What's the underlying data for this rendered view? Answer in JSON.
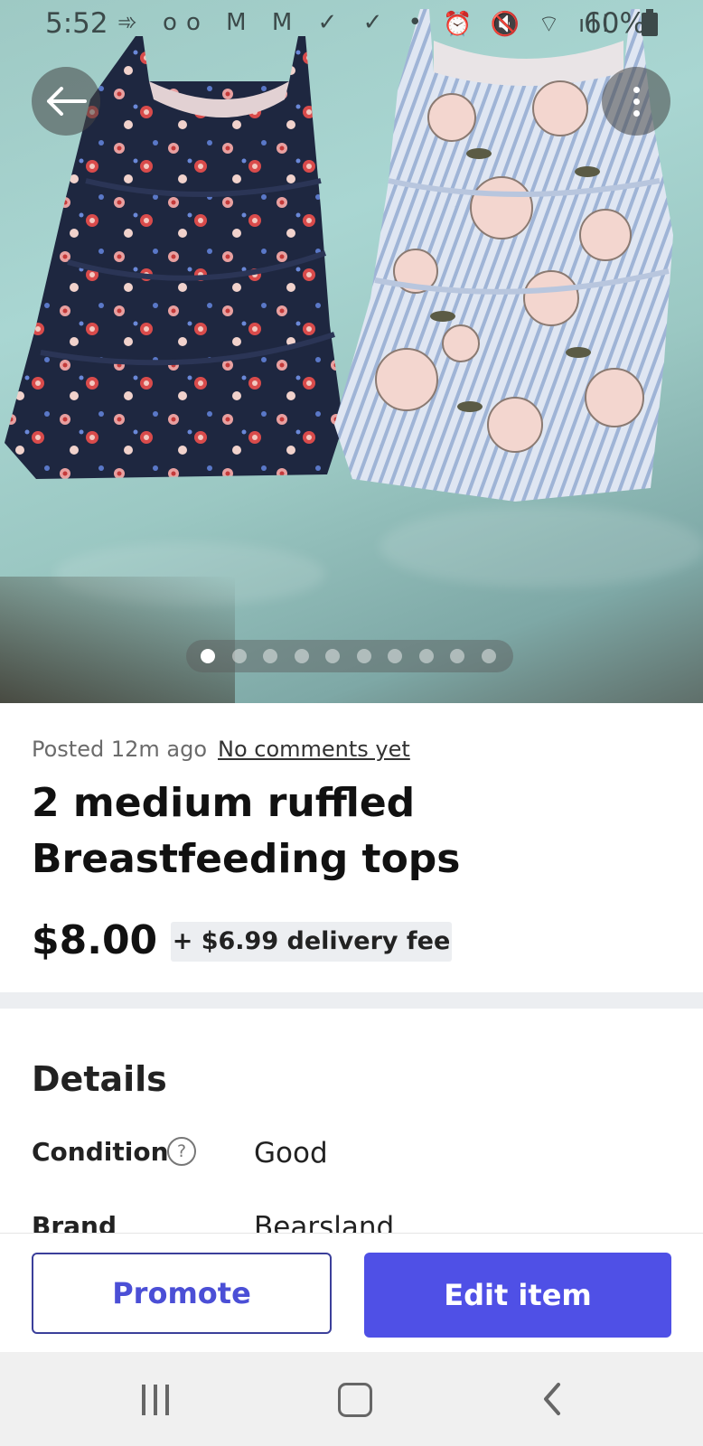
{
  "status_bar": {
    "time": "5:52",
    "left_icons": "➾ oo M M ✓ ✓ •",
    "right_icons": "⏰ 🔇 ⌔ ıll",
    "battery": "60%"
  },
  "gallery": {
    "page_count": 10,
    "active_index": 0
  },
  "listing": {
    "posted": "Posted 12m ago",
    "comments_link": "No comments yet",
    "title": "2 medium ruffled Breastfeeding tops",
    "price": "$8.00",
    "delivery_fee": "+ $6.99 delivery fee"
  },
  "details": {
    "heading": "Details",
    "rows": [
      {
        "label": "Condition",
        "value": "Good"
      },
      {
        "label": "Brand",
        "value": "Bearsland"
      }
    ]
  },
  "actions": {
    "promote_label": "Promote",
    "edit_label": "Edit item"
  },
  "colors": {
    "accent": "#4f50e6",
    "badge_bg": "#eceef1"
  }
}
